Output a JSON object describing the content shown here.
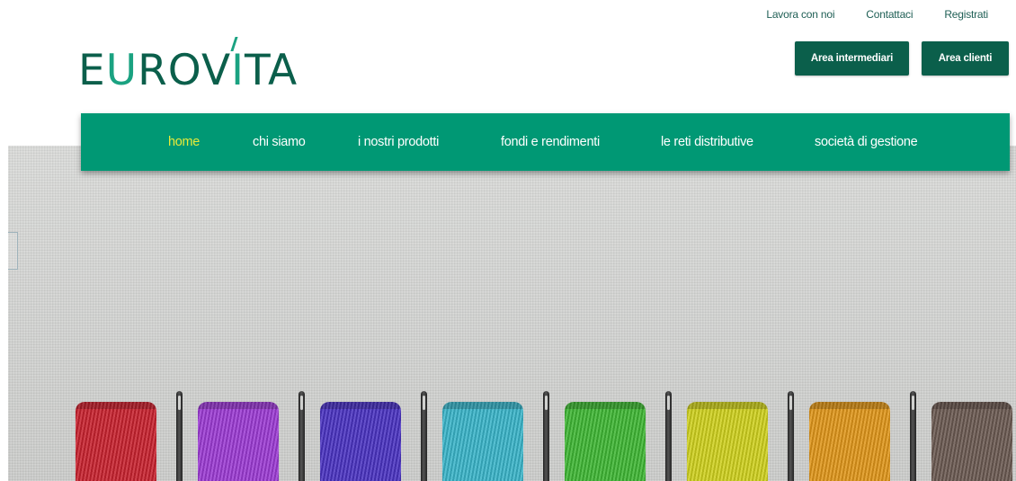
{
  "header": {
    "logo_text": "EUROVITA",
    "logo_parts": [
      "E",
      "U",
      "R",
      "O",
      "V",
      "I",
      "T",
      "A"
    ],
    "top_links": [
      "Lavora con noi",
      "Contattaci",
      "Registrati"
    ],
    "buttons": {
      "intermediari": "Area intermediari",
      "clienti": "Area clienti"
    }
  },
  "nav": {
    "items": [
      {
        "label": "home",
        "active": true
      },
      {
        "label": "chi siamo",
        "active": false
      },
      {
        "label": "i nostri prodotti",
        "active": false
      },
      {
        "label": "fondi e rendimenti",
        "active": false
      },
      {
        "label": "le reti distributive",
        "active": false
      },
      {
        "label": "società di gestione",
        "active": false
      }
    ]
  },
  "hero": {
    "spool_colors": [
      "#c8222f",
      "#9c3bd4",
      "#4a33c2",
      "#3ab5c9",
      "#3fb734",
      "#cfd11e",
      "#e0961a",
      "#6b5a52"
    ]
  },
  "colors": {
    "brand_dark": "#0b5f4b",
    "brand_green": "#009874",
    "brand_accent": "#1aa281",
    "nav_active": "#e8ea3a"
  }
}
